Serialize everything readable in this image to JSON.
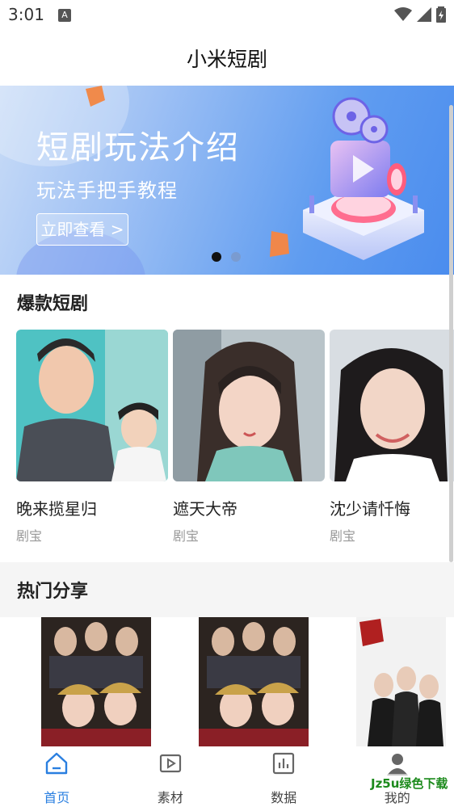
{
  "status_bar": {
    "time": "3:01",
    "notif_letter": "A"
  },
  "header": {
    "title": "小米短剧"
  },
  "banner": {
    "title": "短剧玩法介绍",
    "subtitle": "玩法手把手教程",
    "button_label": "立即查看 >",
    "page_count": 2,
    "active_page": 1
  },
  "hot_dramas": {
    "section_title": "爆款短剧",
    "items": [
      {
        "name": "晚来揽星归",
        "source": "剧宝"
      },
      {
        "name": "遮天大帝",
        "source": "剧宝"
      },
      {
        "name": "沈少请忏悔",
        "source": "剧宝"
      }
    ]
  },
  "hot_share": {
    "section_title": "热门分享",
    "items": [
      {
        "poster_icon": "drama-poster-palace"
      },
      {
        "poster_icon": "drama-poster-palace"
      },
      {
        "poster_icon": "drama-poster-general"
      }
    ]
  },
  "bottom_nav": {
    "items": [
      {
        "label": "首页",
        "icon": "home-icon",
        "active": true
      },
      {
        "label": "素材",
        "icon": "video-icon",
        "active": false
      },
      {
        "label": "数据",
        "icon": "bar-chart-icon",
        "active": false
      },
      {
        "label": "我的",
        "icon": "user-icon",
        "active": false
      }
    ]
  },
  "watermark": "Jz5u绿色下载",
  "colors": {
    "accent": "#2a7fe0",
    "banner_start": "#c9dcf7",
    "banner_end": "#4a8cee"
  }
}
